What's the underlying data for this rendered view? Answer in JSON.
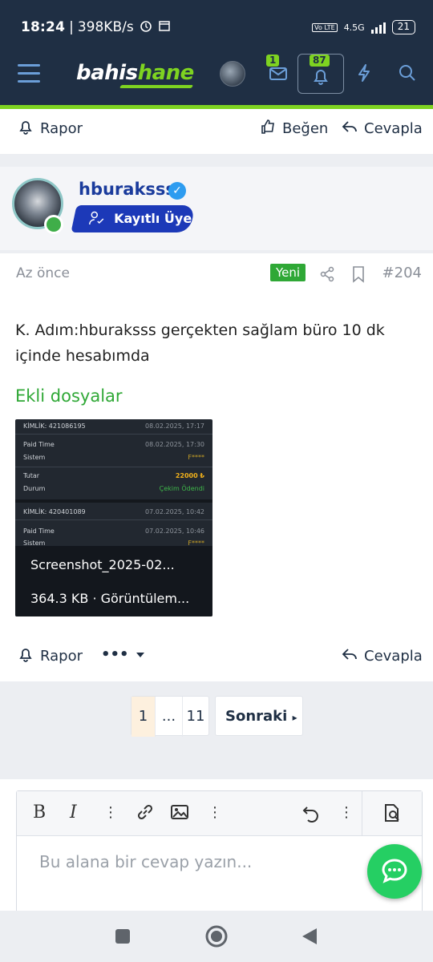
{
  "status_bar": {
    "time": "18:24",
    "speed": "398KB/s",
    "network": "4.5G",
    "volte": "Vo LTE",
    "battery": "21"
  },
  "header": {
    "logo_part1": "bahis",
    "logo_part2": "hane",
    "messages_badge": "1",
    "notifications_badge": "87",
    "accent_color": "#7ed321",
    "bg_color": "#1f2f44"
  },
  "prev_post": {
    "report_label": "Rapor",
    "like_label": "Beğen",
    "reply_label": "Cevapla"
  },
  "post": {
    "username": "hburaksss",
    "role": "Kayıtlı Üye",
    "time": "Az önce",
    "new_label": "Yeni",
    "post_number": "#204",
    "message": "K. Adım:hburaksss gerçekten sağlam büro 10 dk içinde hesabımda",
    "attachments_heading": "Ekli dosyalar",
    "attachment": {
      "name": "Screenshot_2025-02...",
      "info": "364.3 KB · Görüntülem...",
      "preview": {
        "row1_label": "KİMLİK: 421086195",
        "row1_date": "08.02.2025, 17:17",
        "row2_label": "Paid Time",
        "row2_date": "08.02.2025, 17:30",
        "row3_label": "Sistem",
        "row3_value": "F****",
        "row4_label": "Tutar",
        "row4_value": "22000 ₺",
        "row5_label": "Durum",
        "row5_value": "Çekim Ödendi",
        "row6_label": "KİMLİK: 420401089",
        "row6_date": "07.02.2025, 10:42",
        "row7_label": "Paid Time",
        "row7_date": "07.02.2025, 10:46",
        "row8_label": "Sistem",
        "row8_value": "F****"
      }
    },
    "report_label": "Rapor",
    "more_label": "•••",
    "reply_label": "Cevapla"
  },
  "pagination": {
    "current": "1",
    "dots": "...",
    "last": "11",
    "next_label": "Sonraki"
  },
  "editor": {
    "placeholder": "Bu alana bir cevap yazın...",
    "bold": "B",
    "italic": "I"
  }
}
